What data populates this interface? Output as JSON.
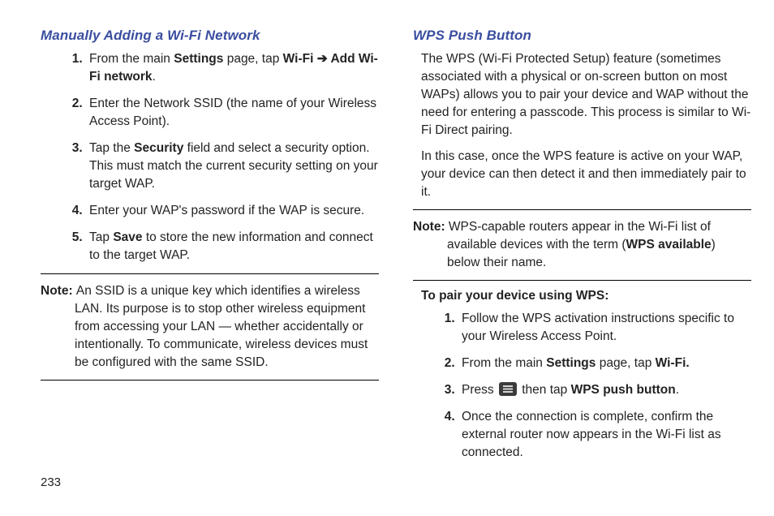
{
  "pageNumber": "233",
  "left": {
    "heading": "Manually Adding a Wi-Fi Network",
    "steps": {
      "s1a": "From the main ",
      "s1b": "Settings",
      "s1c": " page, tap ",
      "s1d": "Wi-Fi",
      "s1e": " ➔ ",
      "s1f": "Add Wi-Fi network",
      "s1g": ".",
      "s2": "Enter the Network SSID (the name of your Wireless Access Point).",
      "s3a": "Tap the ",
      "s3b": "Security",
      "s3c": " field and select a security option. This must match the current security setting on your target WAP.",
      "s4": "Enter your WAP's password if the WAP is secure.",
      "s5a": "Tap ",
      "s5b": "Save",
      "s5c": " to store the new information and connect to the target WAP."
    },
    "noteLabel": "Note: ",
    "noteText": "An SSID is a unique key which identifies a wireless LAN. Its purpose is to stop other wireless equipment from accessing your LAN — whether accidentally or intentionally. To communicate, wireless devices must be configured with the same SSID."
  },
  "right": {
    "heading": "WPS Push Button",
    "para1": "The WPS (Wi-Fi Protected Setup) feature (sometimes associated with a physical or on-screen button on most WAPs) allows you to pair your device and WAP without the need for entering a passcode. This process is similar to Wi-Fi Direct pairing.",
    "para2": "In this case, once the WPS feature is active on your WAP, your device can then detect it and then immediately pair to it.",
    "noteLabel": "Note: ",
    "noteA": "WPS-capable routers appear in the Wi-Fi list of available devices with the term (",
    "noteB": "WPS available",
    "noteC": ") below their name.",
    "subhead": "To pair your device using WPS:",
    "steps": {
      "s1": "Follow the WPS activation instructions specific to your Wireless Access Point.",
      "s2a": "From the main ",
      "s2b": "Settings",
      "s2c": " page, tap ",
      "s2d": "Wi-Fi.",
      "s3a": "Press ",
      "s3b": " then tap ",
      "s3c": "WPS push button",
      "s3d": ".",
      "s4": "Once the connection is complete, confirm the external router now appears in the Wi-Fi list as connected."
    }
  }
}
